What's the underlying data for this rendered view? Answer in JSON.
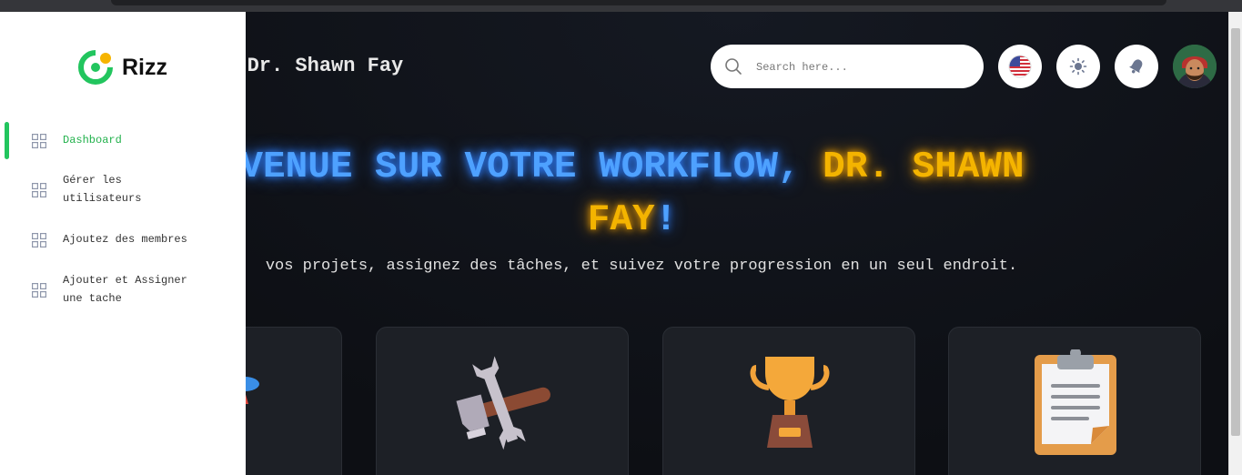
{
  "app": {
    "name": "Rizz"
  },
  "header": {
    "greeting_partial": "ue Dr. Shawn Fay",
    "search_placeholder": "Search here..."
  },
  "icons": {
    "search": "search-icon",
    "language": "us-flag-icon",
    "theme": "sun-icon",
    "notifications": "bell-icon",
    "avatar": "user-avatar"
  },
  "sidebar": {
    "items": [
      {
        "label_line1": "Dashboard",
        "label_line2": "",
        "active": true
      },
      {
        "label_line1": "Gérer les",
        "label_line2": "utilisateurs",
        "active": false
      },
      {
        "label_line1": "Ajoutez des membres",
        "label_line2": "",
        "active": false
      },
      {
        "label_line1": "Ajouter et Assigner",
        "label_line2": "une tache",
        "active": false
      }
    ]
  },
  "hero": {
    "title_blue": "VENUE SUR VOTRE WORKFLOW, ",
    "title_gold_1": "DR. SHAWN",
    "title_gold_2": "FAY",
    "title_end": "!",
    "subtitle": "vos projets, assignez des tâches, et suivez votre progression en un seul endroit."
  },
  "cards": [
    {
      "icon": "rocket-icon"
    },
    {
      "icon": "tools-icon"
    },
    {
      "icon": "trophy-icon"
    },
    {
      "icon": "clipboard-icon"
    }
  ],
  "colors": {
    "accent_green": "#22c55e",
    "title_blue": "#4ea1ff",
    "title_gold": "#f4b400",
    "background": "#0e1015"
  }
}
